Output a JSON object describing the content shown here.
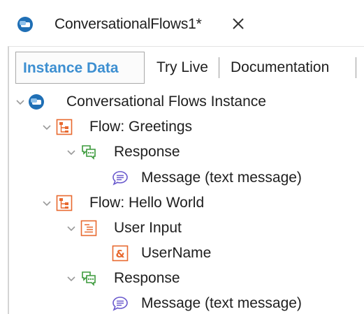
{
  "document_tab": {
    "title": "ConversationalFlows1*",
    "icon": "conversational-flows-icon",
    "close_icon": "close-icon"
  },
  "tabs": [
    {
      "label": "Instance Data",
      "active": true
    },
    {
      "label": "Try Live",
      "active": false
    },
    {
      "label": "Documentation",
      "active": false
    }
  ],
  "tree": {
    "root": {
      "label": "Conversational Flows Instance",
      "icon": "conversational-flows-icon",
      "expanded": true
    },
    "flows": [
      {
        "label": "Flow: Greetings",
        "icon": "flow-icon",
        "expanded": true,
        "response": {
          "label": "Response",
          "icon": "response-icon",
          "expanded": true,
          "message": {
            "label": "Message (text message)",
            "icon": "message-icon"
          }
        }
      },
      {
        "label": "Flow: Hello World",
        "icon": "flow-icon",
        "expanded": true,
        "user_input": {
          "label": "User Input",
          "icon": "user-input-icon",
          "expanded": true,
          "variable": {
            "label": "UserName",
            "icon": "variable-icon"
          }
        },
        "response": {
          "label": "Response",
          "icon": "response-icon",
          "expanded": true,
          "message": {
            "label": "Message (text message)",
            "icon": "message-icon"
          }
        }
      }
    ]
  },
  "colors": {
    "accent": "#3d8fd1",
    "flow_icon": "#e8692f",
    "response_icon": "#3c9a3c",
    "message_icon": "#6a5acd",
    "conversational_icon": "#1f6fb5"
  }
}
